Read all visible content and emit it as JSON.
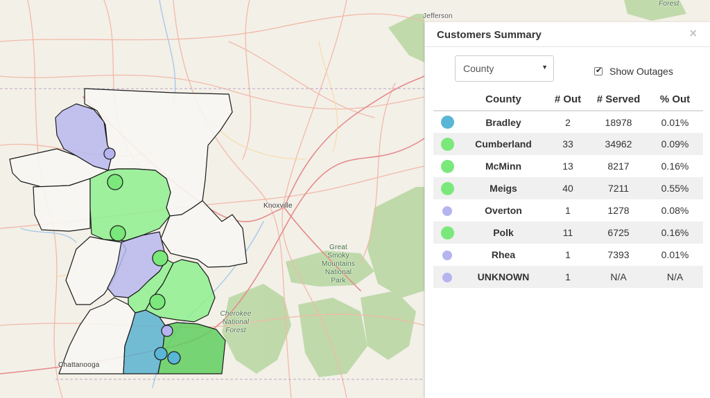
{
  "map": {
    "labels": {
      "knoxville": "Knoxville",
      "chattanooga": "Chattanooga",
      "park": [
        "Great",
        "Smoky",
        "Mountains",
        "National",
        "Park"
      ],
      "forest_cherokee": [
        "Cherokee",
        "National",
        "Forest"
      ],
      "forest_top": "Forest",
      "jefferson": "Jefferson"
    },
    "colors": {
      "blue_fill": "#5bb3cf",
      "green_fill": "#8ef08e",
      "purple_fill": "#b9b8ee",
      "blue_marker": "#59b6d6",
      "green_marker": "#7be87b",
      "purple_marker": "#b5b4f0"
    }
  },
  "panel": {
    "title": "Customers Summary",
    "close_icon": "×",
    "select": {
      "value": "County",
      "caret": "▼"
    },
    "show_outages": {
      "label": "Show Outages",
      "checked": true,
      "tick": "✔"
    },
    "columns": [
      "",
      "County",
      "# Out",
      "# Served",
      "% Out"
    ],
    "rows": [
      {
        "county": "Bradley",
        "out": "2",
        "served": "18978",
        "pct": "0.01%",
        "color": "#59b6d6"
      },
      {
        "county": "Cumberland",
        "out": "33",
        "served": "34962",
        "pct": "0.09%",
        "color": "#7be87b"
      },
      {
        "county": "McMinn",
        "out": "13",
        "served": "8217",
        "pct": "0.16%",
        "color": "#7be87b"
      },
      {
        "county": "Meigs",
        "out": "40",
        "served": "7211",
        "pct": "0.55%",
        "color": "#7be87b"
      },
      {
        "county": "Overton",
        "out": "1",
        "served": "1278",
        "pct": "0.08%",
        "color": "#b5b4f0"
      },
      {
        "county": "Polk",
        "out": "11",
        "served": "6725",
        "pct": "0.16%",
        "color": "#7be87b"
      },
      {
        "county": "Rhea",
        "out": "1",
        "served": "7393",
        "pct": "0.01%",
        "color": "#b5b4f0"
      },
      {
        "county": "UNKNOWN",
        "out": "1",
        "served": "N/A",
        "pct": "N/A",
        "color": "#b5b4f0"
      }
    ]
  }
}
